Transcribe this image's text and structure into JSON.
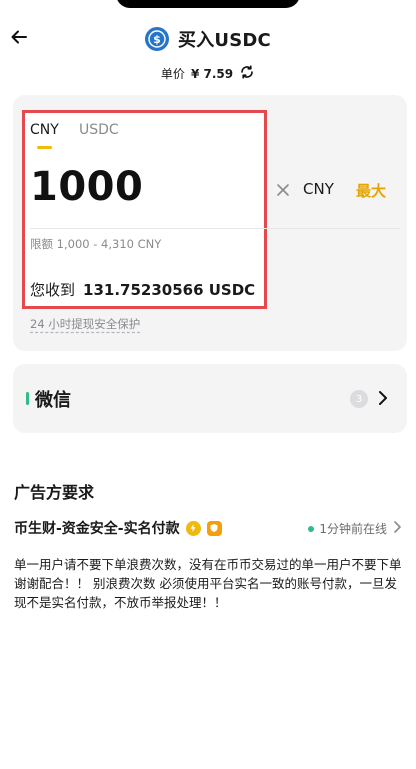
{
  "header": {
    "title": "买入USDC",
    "coin_icon": "usdc-coin-icon"
  },
  "price": {
    "label": "单价",
    "value": "¥ 7.59"
  },
  "form": {
    "tabs": [
      "CNY",
      "USDC"
    ],
    "active_tab": "CNY",
    "amount_value": "1000",
    "currency_unit": "CNY",
    "max_label": "最大",
    "limit_text": "限额 1,000 - 4,310 CNY",
    "receive_label": "您收到",
    "receive_value": "131.75230566 USDC",
    "protect_text": "24 小时提现安全保护"
  },
  "payment": {
    "method": "微信",
    "count": "3",
    "accent_color": "#2ebd85"
  },
  "advertiser": {
    "section_title": "广告方要求",
    "merchant_name": "币生财-资金安全-实名付款",
    "online_status": "1分钟前在线",
    "remark": "单一用户请不要下单浪费次数，没有在币币交易过的单一用户不要下单谢谢配合！！ 别浪费次数 必须使用平台实名一致的账号付款，一旦发现不是实名付款，不放币举报处理！！"
  },
  "colors": {
    "highlight_border": "#e5484d",
    "max_button": "#e6a400",
    "tab_underline": "#f0b90b"
  }
}
